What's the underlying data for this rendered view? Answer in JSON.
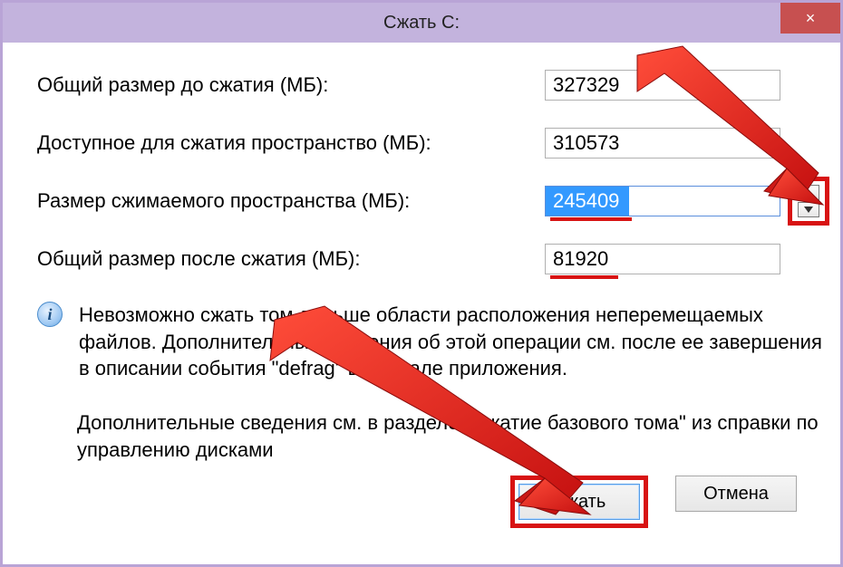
{
  "title": "Сжать C:",
  "close_text": "×",
  "fields": {
    "total_before": {
      "label": "Общий размер до сжатия (МБ):",
      "value": "327329"
    },
    "available": {
      "label": "Доступное для сжатия пространство (МБ):",
      "value": "310573"
    },
    "shrink_amount": {
      "label": "Размер сжимаемого пространства (МБ):",
      "value": "245409"
    },
    "total_after": {
      "label": "Общий размер после сжатия (МБ):",
      "value": "81920"
    }
  },
  "info1": "Невозможно сжать том дальше области расположения неперемещаемых файлов. Дополнительные сведения об этой операции см. после ее завершения в описании события \"defrag\" в журнале приложения.",
  "info2": "Дополнительные сведения см. в разделе \"Сжатие базового тома\" из справки по управлению дисками",
  "buttons": {
    "shrink": "Сжать",
    "cancel": "Отмена"
  },
  "annotation_color": "#d81313"
}
